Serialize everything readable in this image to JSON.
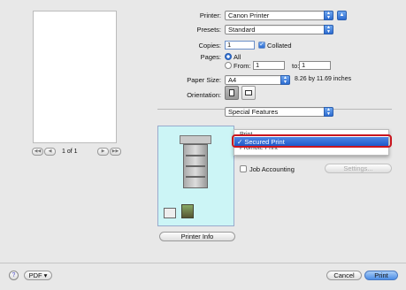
{
  "preview": {
    "page_indicator": "1 of 1",
    "first": "◀◀",
    "prev": "◀",
    "next": "▶",
    "last": "▶▶"
  },
  "printer": {
    "label": "Printer:",
    "value": "Canon Printer"
  },
  "presets": {
    "label": "Presets:",
    "value": "Standard"
  },
  "copies": {
    "label": "Copies:",
    "value": "1",
    "collated_label": "Collated"
  },
  "pages": {
    "label": "Pages:",
    "all_label": "All",
    "from_label": "From:",
    "from_value": "1",
    "to_label": "to:",
    "to_value": "1"
  },
  "paper": {
    "label": "Paper Size:",
    "value": "A4",
    "dimensions": "8.26 by 11.69 inches"
  },
  "orientation": {
    "label": "Orientation:"
  },
  "panel": {
    "value": "Special Features"
  },
  "menu": {
    "items": [
      "Print",
      "✓ Secured Print",
      "Promote Print"
    ],
    "selected_index": 1
  },
  "job_accounting": {
    "label": "Job Accounting",
    "settings_label": "Settings..."
  },
  "printer_info_label": "Printer Info",
  "bottom": {
    "help": "?",
    "pdf_label": "PDF ▾",
    "cancel_label": "Cancel",
    "print_label": "Print"
  }
}
